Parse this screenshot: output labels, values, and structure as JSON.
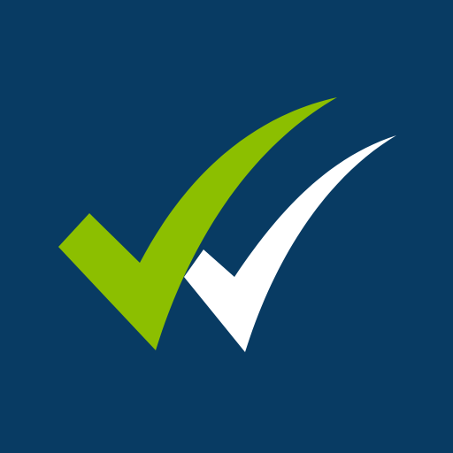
{
  "icon": {
    "name": "double-checkmark-logo",
    "colors": {
      "background": "#083b63",
      "primary_check": "#8cbf00",
      "secondary_check": "#ffffff"
    }
  }
}
